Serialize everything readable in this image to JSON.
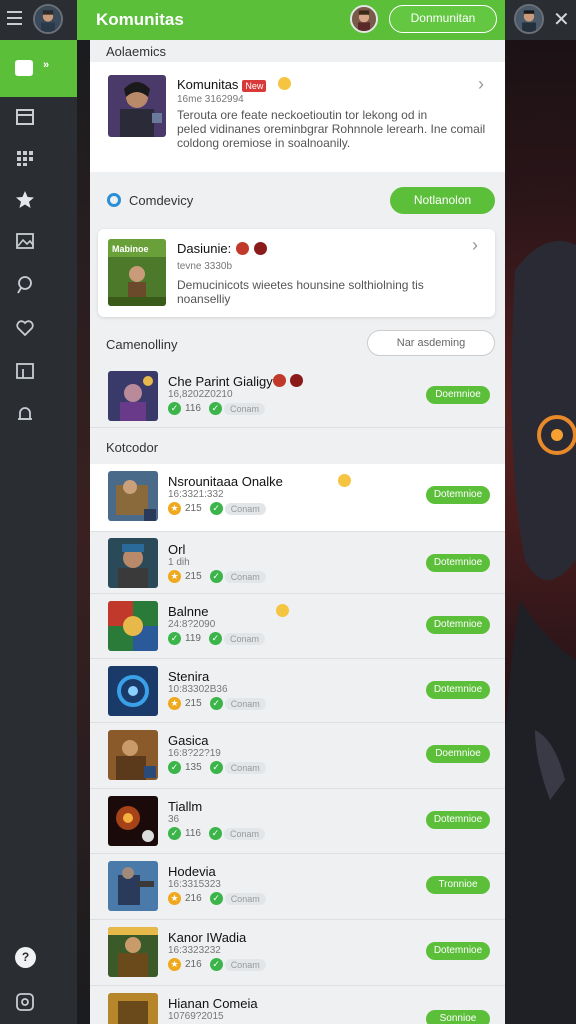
{
  "app": {
    "title": "Komunitas",
    "top_button": "Donmunitan",
    "close_glyph": "✕",
    "accent": "#5cbf3a"
  },
  "sidebar": {
    "active_chevron": "»",
    "items": [
      "calendar-icon",
      "grid-icon",
      "star-icon",
      "image-icon",
      "pin-icon",
      "heart-icon",
      "board-icon",
      "bell-icon"
    ],
    "help_glyph": "?",
    "bottom_glyph": "⌂"
  },
  "achievements": {
    "heading": "Aolaemics",
    "title": "Komunitas",
    "tag": "New",
    "subtitle": "16me 3162994",
    "desc1": "Terouta ore feate neckoetioutin tor lekong od in",
    "desc2": "peled vidinanes oreminbgrar Rohnnole lerearh. Ine comail",
    "desc3": "coldong oremiose in soalnoanily."
  },
  "community": {
    "label": "Comdevicy",
    "button": "Notlanolon",
    "card_title": "Dasiunie:",
    "card_sub": "tevne 3330b",
    "card_desc1": "Demucinicots wieetes hounsine solthiolning tis",
    "card_desc2": "noanselliy",
    "thumb_text": "Mabinoe"
  },
  "section2": {
    "heading": "Camenolliny",
    "filter_button": "Nar asdeming"
  },
  "section3": {
    "heading": "Kotcodor"
  },
  "rows": [
    {
      "title": "Che Parint Gialigy",
      "sub": "16,8202Z0210",
      "n": "116",
      "badge": "g",
      "pill": "Conam",
      "btn": "Doemnioe"
    },
    {
      "title": "Nsrounitaaa Onalke",
      "sub": "16:3321:332",
      "n": "215",
      "badge": "o",
      "pill": "Conam",
      "btn": "Dotemnioe"
    },
    {
      "title": "Orl",
      "sub": "1 dih",
      "n": "215",
      "badge": "o",
      "pill": "Conam",
      "btn": "Dotemnioe"
    },
    {
      "title": "Balnne",
      "sub": "24:8?2090",
      "n": "119",
      "badge": "g",
      "pill": "Conam",
      "btn": "Dotemnioe"
    },
    {
      "title": "Stenira",
      "sub": "10:83302B36",
      "n": "215",
      "badge": "o",
      "pill": "Conam",
      "btn": "Dotemnioe"
    },
    {
      "title": "Gasica",
      "sub": "16:8?22?19",
      "n": "135",
      "badge": "g",
      "pill": "Conam",
      "btn": "Doemnioe"
    },
    {
      "title": "Tiallm",
      "sub": "36",
      "n": "116",
      "badge": "g",
      "pill": "Conam",
      "btn": "Dotemnioe"
    },
    {
      "title": "Hodevia",
      "sub": "16:3315323",
      "n": "216",
      "badge": "o",
      "pill": "Conam",
      "btn": "Tronnioe"
    },
    {
      "title": "Kanor IWadia",
      "sub": "16:3323232",
      "n": "216",
      "badge": "o",
      "pill": "Conam",
      "btn": "Dotemnioe"
    },
    {
      "title": "Hianan Comeia",
      "sub": "10769?2015",
      "n": "",
      "badge": "",
      "pill": "",
      "btn": "Sonnioe"
    }
  ]
}
